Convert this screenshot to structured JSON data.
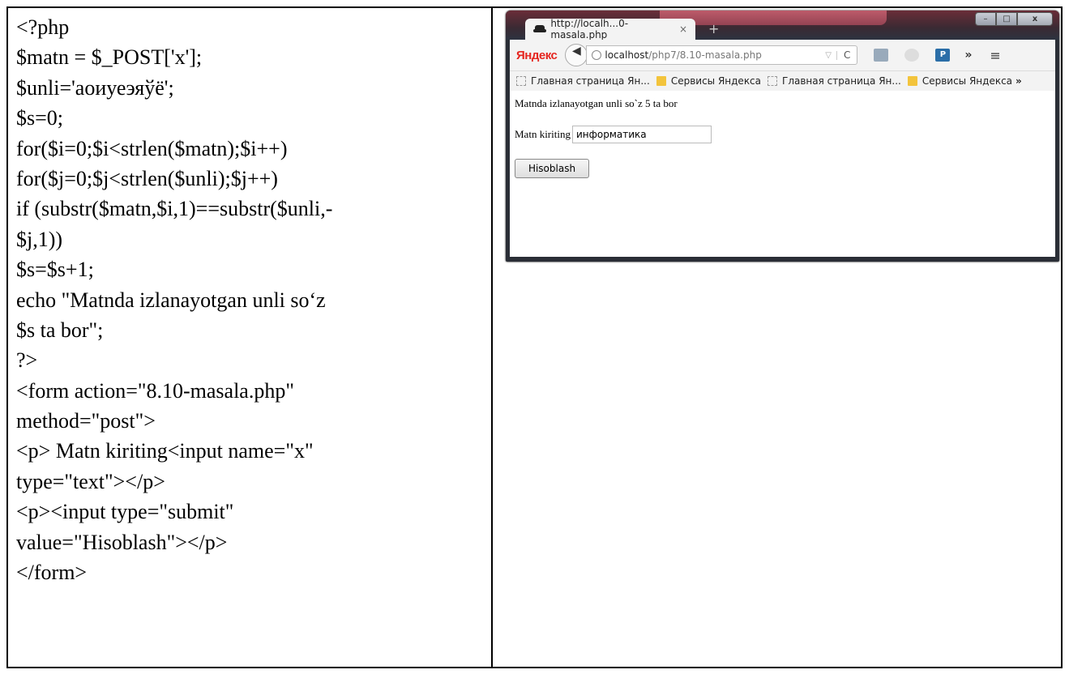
{
  "code_lines": [
    "<?php",
    "$matn = $_POST['x'];",
    "$unli='аоиуеэяўё';",
    "$s=0;",
    "for($i=0;$i<strlen($matn);$i++)",
    "for($j=0;$j<strlen($unli);$j++)",
    "if (substr($matn,$i,1)==substr($unli,-",
    "$j,1))",
    "$s=$s+1;",
    "echo \"Matnda izlanayotgan unli so‘z",
    "$s ta bor\";",
    "?>",
    "<form action=\"8.10-masala.php\"",
    "method=\"post\">",
    "<p> Matn kiriting<input name=\"x\"",
    "type=\"text\"></p>",
    "<p><input type=\"submit\"",
    "value=\"Hisoblash\"></p>",
    "</form>"
  ],
  "browser": {
    "tab_title": "http://localh...0-masala.php",
    "tab_close": "×",
    "new_tab": "+",
    "window_buttons": {
      "minimize": "–",
      "maximize": "□",
      "close": "x"
    },
    "yandex_logo": "Яндекс",
    "url_host": "localhost",
    "url_path": "/php7/8.10-masala.php",
    "url_dropdown": "▽",
    "reload": "C",
    "more": "»",
    "menu": "≡",
    "bookmarks": [
      {
        "label": "Главная страница Ян...",
        "icon": "page-icon"
      },
      {
        "label": "Сервисы Яндекса",
        "icon": "folder-icon"
      },
      {
        "label": "Главная страница Ян...",
        "icon": "page-icon"
      },
      {
        "label": "Сервисы Яндекса",
        "icon": "folder-icon"
      }
    ],
    "bookmarks_more": "»",
    "page": {
      "result_text": "Matnda izlanayotgan unli so`z 5 ta bor",
      "input_label": "Matn kiriting",
      "input_value": "информатика",
      "submit_label": "Hisoblash"
    }
  }
}
